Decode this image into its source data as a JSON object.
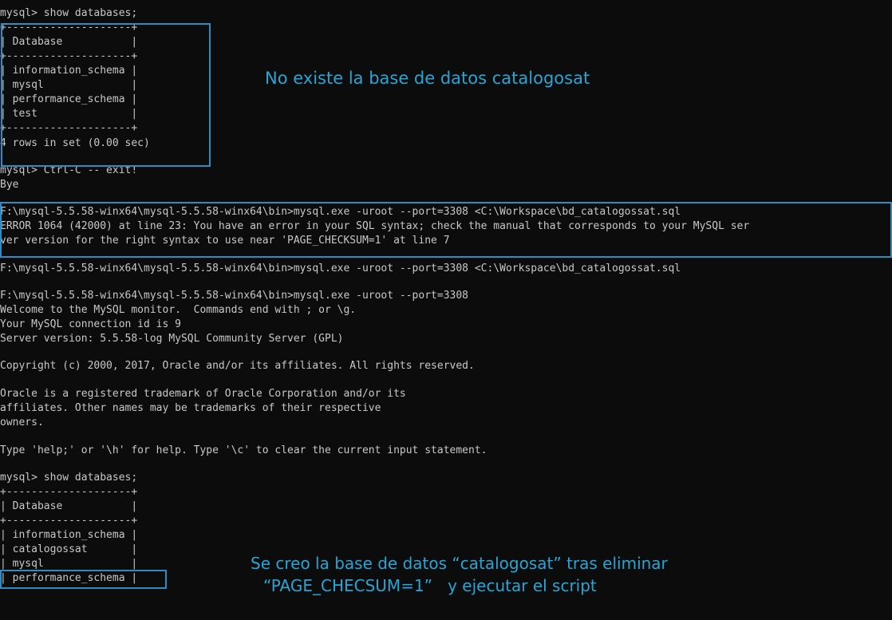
{
  "terminal": {
    "lines": [
      "mysql> show databases;",
      "+--------------------+",
      "| Database           |",
      "+--------------------+",
      "| information_schema |",
      "| mysql              |",
      "| performance_schema |",
      "| test               |",
      "+--------------------+",
      "4 rows in set (0.00 sec)",
      "mysql> Ctrl-C -- exit!",
      "Bye",
      "F:\\mysql-5.5.58-winx64\\mysql-5.5.58-winx64\\bin>mysql.exe -uroot --port=3308 <C:\\Workspace\\bd_catalogossat.sql",
      "ERROR 1064 (42000) at line 23: You have an error in your SQL syntax; check the manual that corresponds to your MySQL ser",
      "ver version for the right syntax to use near 'PAGE_CHECKSUM=1' at line 7",
      "F:\\mysql-5.5.58-winx64\\mysql-5.5.58-winx64\\bin>mysql.exe -uroot --port=3308 <C:\\Workspace\\bd_catalogossat.sql",
      "F:\\mysql-5.5.58-winx64\\mysql-5.5.58-winx64\\bin>mysql.exe -uroot --port=3308",
      "Welcome to the MySQL monitor.  Commands end with ; or \\g.",
      "Your MySQL connection id is 9",
      "Server version: 5.5.58-log MySQL Community Server (GPL)",
      "Copyright (c) 2000, 2017, Oracle and/or its affiliates. All rights reserved.",
      "Oracle is a registered trademark of Oracle Corporation and/or its",
      "affiliates. Other names may be trademarks of their respective",
      "owners.",
      "Type 'help;' or '\\h' for help. Type '\\c' to clear the current input statement.",
      "mysql> show databases;",
      "+--------------------+",
      "| Database           |",
      "+--------------------+",
      "| information_schema |",
      "| catalogossat       |",
      "| mysql              |",
      "| performance_schema |"
    ]
  },
  "annotations": {
    "top": "No existe la base de datos catalogosat",
    "bottom_line1": "Se creo la base de datos “catalogosat” tras eliminar",
    "bottom_line2": "“PAGE_CHECSUM=1”   y ejecutar el script"
  },
  "colors": {
    "background": "#0c0c0c",
    "text": "#c8c8c8",
    "annotation": "#27a5d6",
    "highlight_border": "#2e8bc4"
  }
}
